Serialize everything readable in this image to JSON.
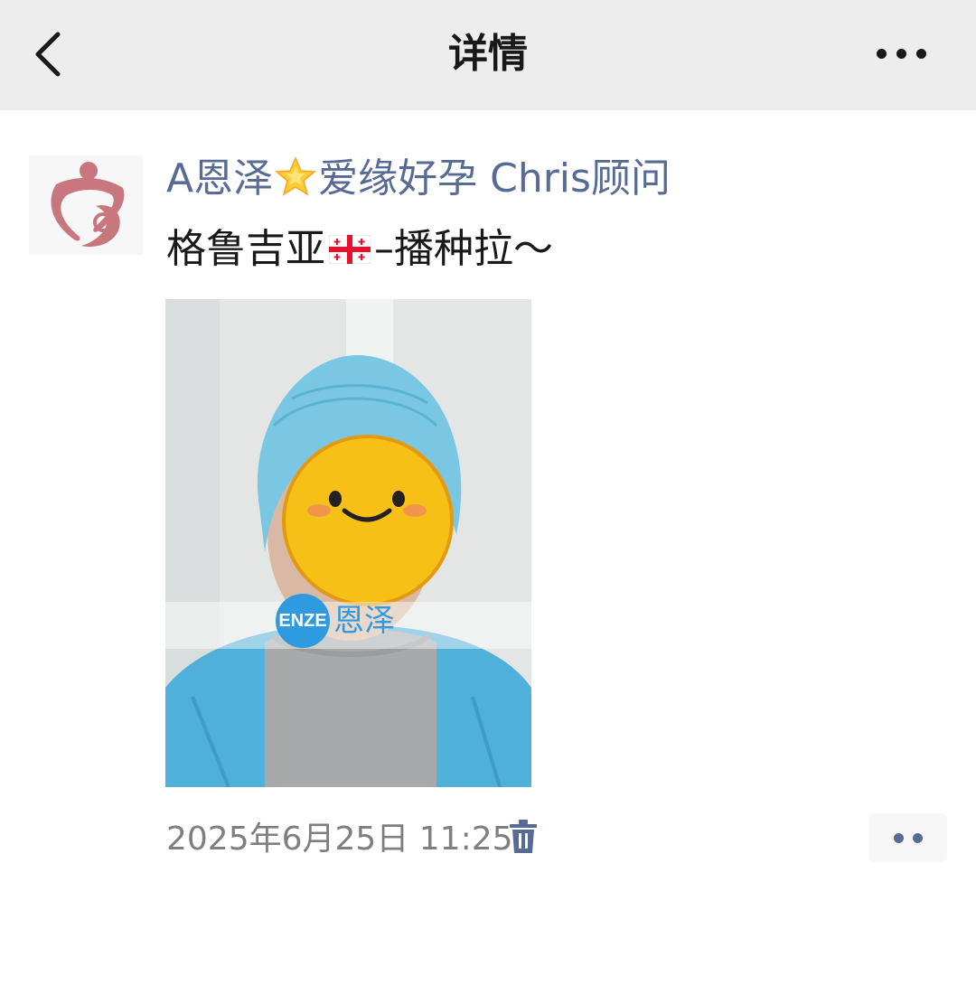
{
  "header": {
    "title": "详情",
    "back_icon": "chevron-left-icon",
    "more_icon": "more-horizontal-icon"
  },
  "post": {
    "author": {
      "name_prefix": "A恩泽",
      "star_icon": "glowing-star-emoji",
      "name_suffix": "爱缘好孕 Chris顾问"
    },
    "content": {
      "text_before_flag": "格鲁吉亚",
      "flag_icon": "georgia-flag-emoji",
      "text_after_flag": "–播种拉～"
    },
    "image": {
      "watermark_logo": "ENZE",
      "watermark_text": "恩泽"
    },
    "timestamp": "2025年6月25日 11:25"
  },
  "colors": {
    "link": "#576b95",
    "header_bg": "#ededed",
    "muted_text": "#7f7f7f"
  }
}
